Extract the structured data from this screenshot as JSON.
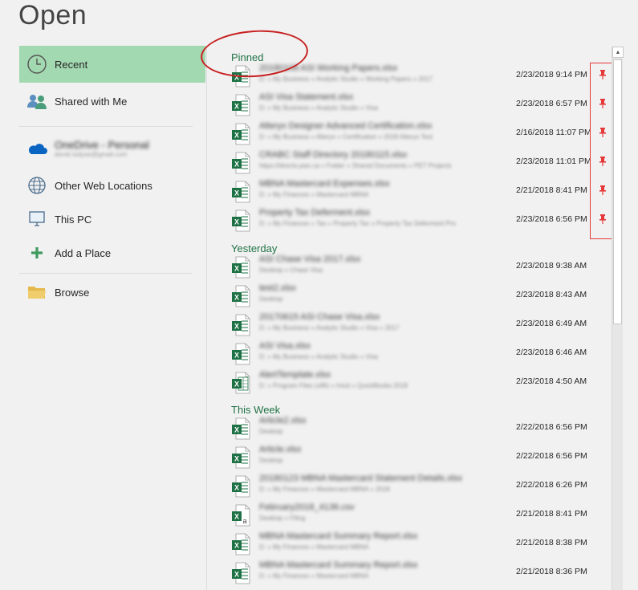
{
  "title": "Open",
  "nav": {
    "recent": "Recent",
    "shared": "Shared with Me",
    "onedrive_name": "OneDrive - Personal",
    "onedrive_email": "derek.todyse@gmail.com",
    "web": "Other Web Locations",
    "pc": "This PC",
    "add": "Add a Place",
    "browse": "Browse"
  },
  "groups": {
    "pinned": "Pinned",
    "yesterday": "Yesterday",
    "week": "This Week"
  },
  "files": [
    {
      "name": "20180108 ASI Working Papers.xlsx",
      "path": "D: » My Business » Analytic Studio » Working Papers » 2017",
      "date": "2/23/2018 9:14 PM",
      "icon": "excel-file-icon",
      "pinned": true
    },
    {
      "name": "ASI Visa Statement.xlsx",
      "path": "D: » My Business » Analytic Studio » Visa",
      "date": "2/23/2018 6:57 PM",
      "icon": "excel-file-icon",
      "pinned": true
    },
    {
      "name": "Alteryx Designer Advanced Certification.xlsx",
      "path": "D: » My Business » Alteryx » Certification » 2018 Alteryx Test",
      "date": "2/16/2018 11:07 PM",
      "icon": "excel-file-icon",
      "pinned": true
    },
    {
      "name": "CRABC Staff Directory 20180115.xlsx",
      "path": "https://directo.pwc.ca » Folder » Shared Documents » PET Projects",
      "date": "2/23/2018 11:01 PM",
      "icon": "excel-file-icon",
      "pinned": true
    },
    {
      "name": "MBNA Mastercard Expenses.xlsx",
      "path": "D: » My Finances » Mastercard MBNA",
      "date": "2/21/2018 8:41 PM",
      "icon": "excel-file-icon",
      "pinned": true
    },
    {
      "name": "Property Tax Deferment.xlsx",
      "path": "D: » My Finances » Tax » Property Tax » Property Tax Deferment Pro",
      "date": "2/23/2018 6:56 PM",
      "icon": "excel-file-icon",
      "pinned": true
    },
    {
      "name": "ASI Chase Visa 2017.xlsx",
      "path": "Desktop » Chase Visa",
      "date": "2/23/2018 9:38 AM",
      "icon": "excel-file-icon",
      "pinned": false
    },
    {
      "name": "test2.xlsx",
      "path": "Desktop",
      "date": "2/23/2018 8:43 AM",
      "icon": "excel-file-icon",
      "pinned": false
    },
    {
      "name": "20170615 ASI Chase Visa.xlsx",
      "path": "D: » My Business » Analytic Studio » Visa » 2017",
      "date": "2/23/2018 6:49 AM",
      "icon": "excel-file-icon",
      "pinned": false
    },
    {
      "name": "ASI Visa.xlsx",
      "path": "D: » My Business » Analytic Studio » Visa",
      "date": "2/23/2018 6:46 AM",
      "icon": "excel-file-icon",
      "pinned": false
    },
    {
      "name": "AlertTemplate.xlsx",
      "path": "D: » Program Files (x86) » Intuit » QuickBooks 2018",
      "date": "2/23/2018 4:50 AM",
      "icon": "excel-template-icon",
      "pinned": false
    },
    {
      "name": "Article2.xlsx",
      "path": "Desktop",
      "date": "2/22/2018 6:56 PM",
      "icon": "excel-file-icon",
      "pinned": false
    },
    {
      "name": "Article.xlsx",
      "path": "Desktop",
      "date": "2/22/2018 6:56 PM",
      "icon": "excel-file-icon",
      "pinned": false
    },
    {
      "name": "20180123 MBNA Mastercard Statement Details.xlsx",
      "path": "D: » My Finances » Mastercard MBNA » 2018",
      "date": "2/22/2018 6:26 PM",
      "icon": "excel-file-icon",
      "pinned": false
    },
    {
      "name": "February2018_4136.csv",
      "path": "Desktop » Filing",
      "date": "2/21/2018 8:41 PM",
      "icon": "csv-file-icon",
      "pinned": false
    },
    {
      "name": "MBNA Mastercard Summary Report.xlsx",
      "path": "D: » My Finances » Mastercard MBNA",
      "date": "2/21/2018 8:38 PM",
      "icon": "excel-file-icon",
      "pinned": false
    },
    {
      "name": "MBNA Mastercard Summary Report.xlsx",
      "path": "D: » My Finances » Mastercard MBNA",
      "date": "2/21/2018 8:36 PM",
      "icon": "excel-file-icon",
      "pinned": false
    }
  ],
  "colors": {
    "accent": "#217346",
    "selected": "#a3d9b1",
    "pin": "#e5393a"
  }
}
